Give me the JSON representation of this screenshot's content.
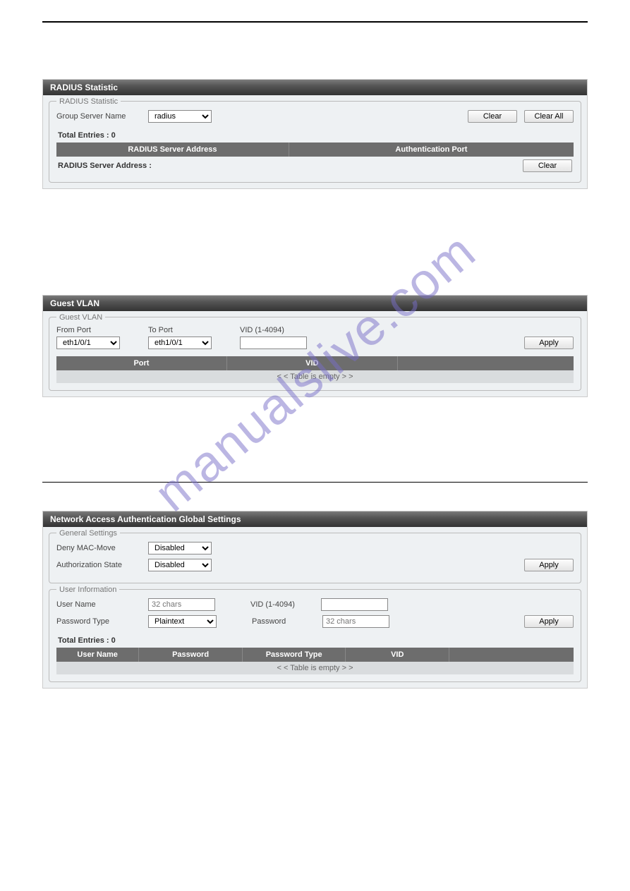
{
  "watermark": "manualslive.com",
  "section1": {
    "heading": "",
    "panel_title": "RADIUS Statistic",
    "fieldset_legend": "RADIUS Statistic",
    "group_server_label": "Group Server Name",
    "group_server_value": "radius",
    "clear_btn": "Clear",
    "clear_all_btn": "Clear All",
    "total_entries": "Total Entries : 0",
    "col_address": "RADIUS Server Address",
    "col_auth_port": "Authentication Port",
    "sub_label": "RADIUS Server Address :",
    "sub_clear": "Clear"
  },
  "section2": {
    "heading": "",
    "panel_title": "Guest VLAN",
    "fieldset_legend": "Guest VLAN",
    "from_port_label": "From Port",
    "from_port_value": "eth1/0/1",
    "to_port_label": "To Port",
    "to_port_value": "eth1/0/1",
    "vid_label": "VID (1-4094)",
    "vid_value": "",
    "apply_btn": "Apply",
    "col_port": "Port",
    "col_vid": "VID",
    "empty_text": "< < Table is empty > >"
  },
  "section3": {
    "heading": "",
    "panel_title": "Network Access Authentication Global Settings",
    "general_legend": "General Settings",
    "deny_mac_label": "Deny MAC-Move",
    "deny_mac_value": "Disabled",
    "auth_state_label": "Authorization State",
    "auth_state_value": "Disabled",
    "apply_btn1": "Apply",
    "user_legend": "User Information",
    "username_label": "User Name",
    "username_placeholder": "32 chars",
    "vid_label": "VID (1-4094)",
    "vid_value": "",
    "pwd_type_label": "Password Type",
    "pwd_type_value": "Plaintext",
    "pwd_label": "Password",
    "pwd_placeholder": "32 chars",
    "apply_btn2": "Apply",
    "total_entries": "Total Entries : 0",
    "col_user": "User Name",
    "col_pwd": "Password",
    "col_pwdtype": "Password Type",
    "col_vid": "VID",
    "empty_text": "< < Table is empty > >"
  }
}
